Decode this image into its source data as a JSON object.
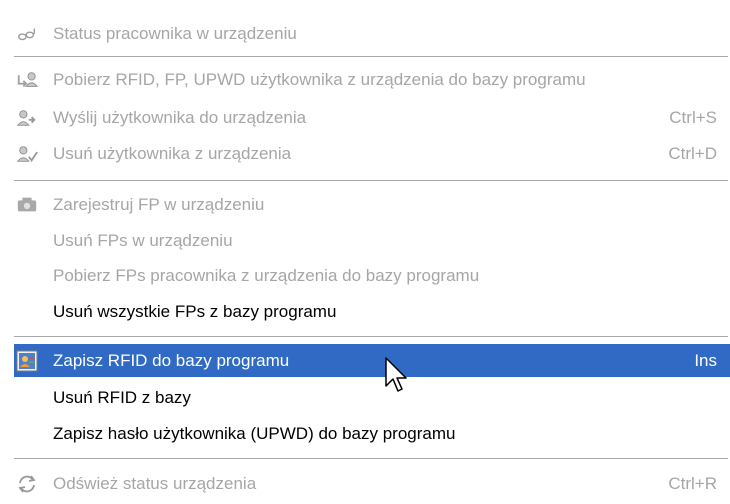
{
  "menu": {
    "status": {
      "label": "Status pracownika w urządzeniu",
      "icon": "footprints-icon"
    },
    "download_user": {
      "label": "Pobierz RFID, FP, UPWD  użytkownika z urządzenia do bazy programu",
      "icon": "user-download-icon"
    },
    "send_user": {
      "label": "Wyślij użytkownika do urządzenia",
      "shortcut": "Ctrl+S",
      "icon": "user-send-icon"
    },
    "delete_user": {
      "label": "Usuń użytkownika z urządzenia",
      "shortcut": "Ctrl+D",
      "icon": "user-delete-icon"
    },
    "register_fp": {
      "label": "Zarejestruj FP w urządzeniu",
      "icon": "fingerprint-register-icon"
    },
    "delete_fps_device": {
      "label": "Usuń FPs w urządzeniu"
    },
    "download_fps": {
      "label": "Pobierz FPs pracownika z urządzenia do bazy programu"
    },
    "delete_all_fps": {
      "label": "Usuń wszystkie FPs z bazy programu"
    },
    "save_rfid": {
      "label": "Zapisz RFID do bazy programu",
      "shortcut": "Ins",
      "icon": "card-save-icon"
    },
    "delete_rfid": {
      "label": "Usuń RFID z bazy"
    },
    "save_password": {
      "label": "Zapisz hasło użytkownika (UPWD) do bazy programu"
    },
    "refresh_status": {
      "label": "Odśwież status urządzenia",
      "shortcut": "Ctrl+R",
      "icon": "refresh-icon"
    }
  },
  "colors": {
    "highlight": "#316ac5",
    "disabled_text": "#a6a6a6",
    "separator": "#a7a6aa"
  }
}
